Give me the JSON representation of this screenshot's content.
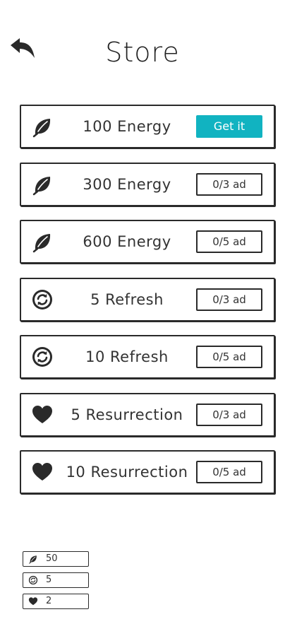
{
  "header": {
    "title": "Store",
    "back_icon": "back-arrow-icon"
  },
  "items": [
    {
      "icon": "leaf-icon",
      "label": "100 Energy",
      "button": "Get it",
      "button_style": "primary"
    },
    {
      "icon": "leaf-icon",
      "label": "300 Energy",
      "button": "0/3 ad",
      "button_style": "outline"
    },
    {
      "icon": "leaf-icon",
      "label": "600 Energy",
      "button": "0/5 ad",
      "button_style": "outline"
    },
    {
      "icon": "refresh-icon",
      "label": "5 Refresh",
      "button": "0/3 ad",
      "button_style": "outline"
    },
    {
      "icon": "refresh-icon",
      "label": "10 Refresh",
      "button": "0/5 ad",
      "button_style": "outline"
    },
    {
      "icon": "heart-icon",
      "label": "5 Resurrection",
      "button": "0/3 ad",
      "button_style": "outline"
    },
    {
      "icon": "heart-icon",
      "label": "10 Resurrection",
      "button": "0/5 ad",
      "button_style": "outline"
    }
  ],
  "balances": [
    {
      "icon": "leaf-icon",
      "value": "50"
    },
    {
      "icon": "refresh-icon",
      "value": "5"
    },
    {
      "icon": "heart-icon",
      "value": "2"
    }
  ],
  "colors": {
    "accent": "#11b3c1",
    "ink": "#2a2a2a",
    "background": "#ffffff"
  }
}
